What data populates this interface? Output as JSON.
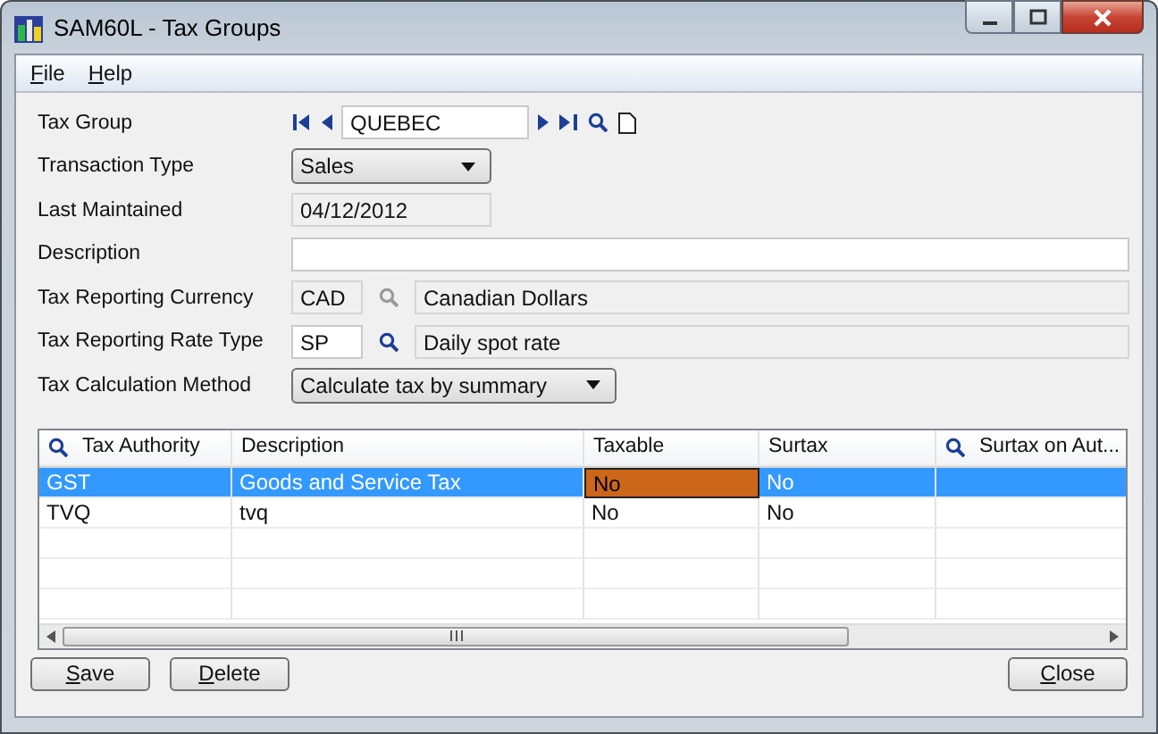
{
  "window": {
    "title": "SAM60L - Tax Groups"
  },
  "menu": [
    {
      "label": "File"
    },
    {
      "label": "Help"
    }
  ],
  "fields": [
    {
      "label": "Tax Group",
      "kind": "finder",
      "value": "QUEBEC"
    },
    {
      "label": "Transaction Type",
      "kind": "dropdown",
      "value": "Sales"
    },
    {
      "label": "Last Maintained",
      "kind": "readonly",
      "value": "04/12/2012"
    },
    {
      "label": "Description",
      "kind": "text"
    },
    {
      "label": "Tax Reporting Currency",
      "kind": "lookup",
      "code": "CAD",
      "disabled": true,
      "name": "Canadian Dollars"
    },
    {
      "label": "Tax Reporting Rate Type",
      "kind": "lookup",
      "code": "SP",
      "disabled": false,
      "name": "Daily spot rate"
    },
    {
      "label": "Tax Calculation Method",
      "kind": "dropdown",
      "value": "Calculate tax by summary"
    }
  ],
  "table": {
    "columns": [
      {
        "label": "Tax Authority",
        "lookup": true
      },
      {
        "label": "Description",
        "lookup": false
      },
      {
        "label": "Taxable",
        "lookup": false
      },
      {
        "label": "Surtax",
        "lookup": false
      },
      {
        "label": "Surtax on Aut...",
        "lookup": true
      }
    ],
    "rows": [
      {
        "selected": true,
        "cells": [
          {
            "text": "GST",
            "focused": false
          },
          {
            "text": "Goods and Service Tax",
            "focused": false
          },
          {
            "text": "No",
            "focused": true
          },
          {
            "text": "No",
            "focused": false
          }
        ]
      },
      {
        "selected": false,
        "cells": [
          {
            "text": "TVQ",
            "focused": false
          },
          {
            "text": "tvq",
            "focused": false
          },
          {
            "text": "No",
            "focused": false
          },
          {
            "text": "No",
            "focused": false
          }
        ]
      }
    ]
  },
  "buttons": [
    {
      "label": "Save"
    },
    {
      "label": "Delete"
    },
    {
      "label": "Close"
    }
  ]
}
